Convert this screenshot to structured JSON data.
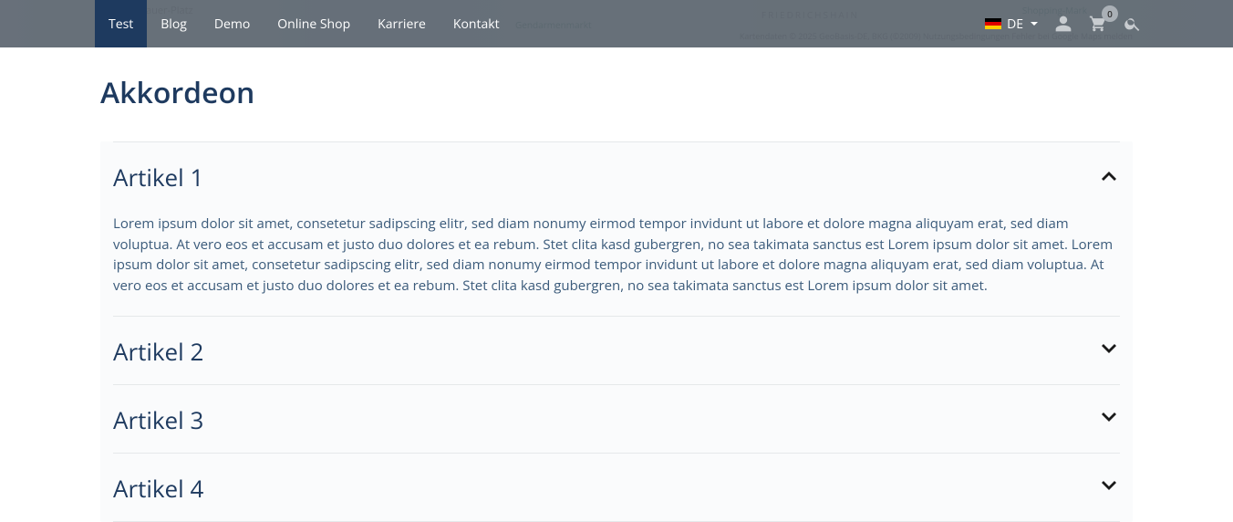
{
  "map": {
    "label1": "Gendarmenmarkt",
    "label2": "Shopping-Mark",
    "attr": "Kartendaten © 2025 GeoBasis-DE, BKG (©2009)    Nutzungsbedingungen    Fehler bei Google Maps melden"
  },
  "nav": {
    "items": [
      "Test",
      "Blog",
      "Demo",
      "Online Shop",
      "Karriere",
      "Kontakt"
    ],
    "activeIndex": 0,
    "lang": "DE",
    "cartCount": "0"
  },
  "section": {
    "title": "Akkordeon"
  },
  "accordion": [
    {
      "title": "Artikel 1",
      "expanded": true,
      "body": "Lorem ipsum dolor sit amet, consetetur sadipscing elitr, sed diam nonumy eirmod tempor invidunt ut labore et dolore magna aliquyam erat, sed diam voluptua. At vero eos et accusam et justo duo dolores et ea rebum. Stet clita kasd gubergren, no sea takimata sanctus est Lorem ipsum dolor sit amet. Lorem ipsum dolor sit amet, consetetur sadipscing elitr, sed diam nonumy eirmod tempor invidunt ut labore et dolore magna aliquyam erat, sed diam voluptua. At vero eos et accusam et justo duo dolores et ea rebum. Stet clita kasd gubergren, no sea takimata sanctus est Lorem ipsum dolor sit amet."
    },
    {
      "title": "Artikel 2",
      "expanded": false
    },
    {
      "title": "Artikel 3",
      "expanded": false
    },
    {
      "title": "Artikel 4",
      "expanded": false
    }
  ]
}
